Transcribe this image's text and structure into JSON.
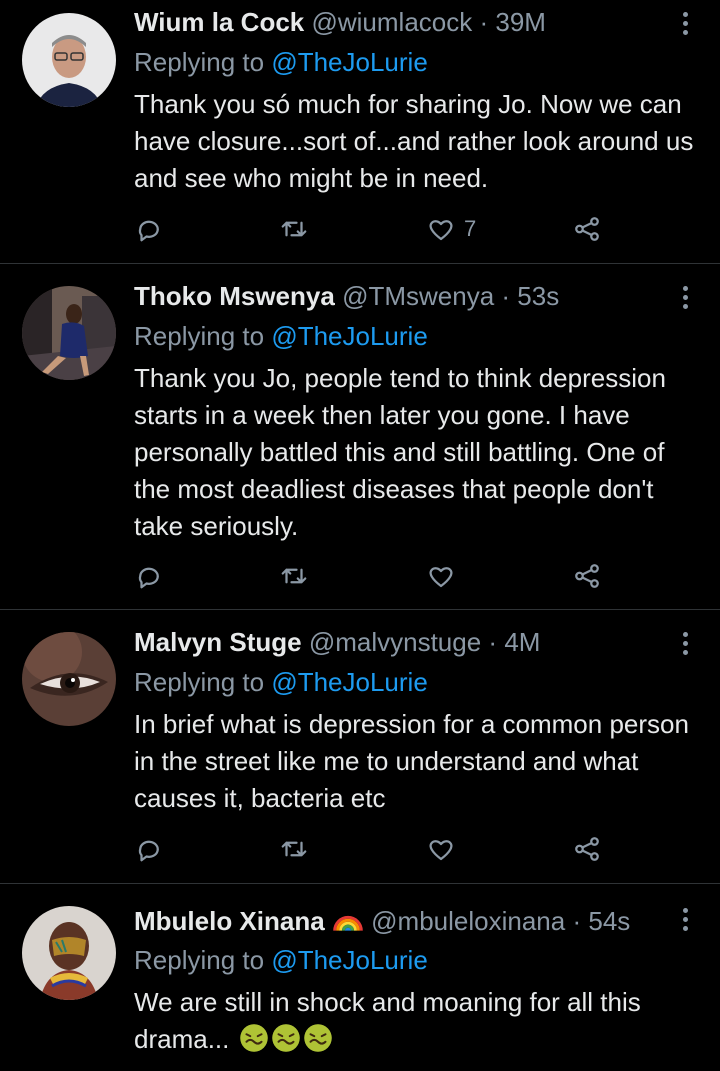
{
  "replying_prefix": "Replying to",
  "tweets": [
    {
      "name": "Wium la Cock",
      "handle": "@wiumlacock",
      "separator": "·",
      "time": "39M",
      "reply_to": "@TheJoLurie",
      "text": "Thank you só much for sharing Jo. Now we can have closure...sort of...and rather look around us and see who might be in need.",
      "like_count": "7"
    },
    {
      "name": "Thoko Mswenya",
      "handle": "@TMswenya",
      "separator": "·",
      "time": "53s",
      "reply_to": "@TheJoLurie",
      "text": "Thank you Jo, people tend to think depression starts in a week then later you gone. I have personally battled this and still battling. One of the most deadliest diseases that people don't take seriously.",
      "like_count": ""
    },
    {
      "name": "Malvyn Stuge",
      "handle": "@malvynstuge",
      "separator": "·",
      "time": "4M",
      "reply_to": "@TheJoLurie",
      "text": "In brief what is depression for a common person in the street like me to understand and what causes it, bacteria etc",
      "like_count": ""
    },
    {
      "name": "Mbulelo Xinana",
      "handle": "@mbuleloxinana",
      "separator": "·",
      "time": "54s",
      "reply_to": "@TheJoLurie",
      "text": "We are still in shock and moaning for all this drama...",
      "emojis": [
        "nauseated-face-emoji",
        "nauseated-face-emoji",
        "nauseated-face-emoji"
      ],
      "name_badge": "rainbow-emoji"
    }
  ],
  "icons": {
    "reply": "reply-icon",
    "retweet": "retweet-icon",
    "like": "heart-icon",
    "share": "share-icon",
    "more": "more-vertical-icon"
  },
  "colors": {
    "background": "#000000",
    "text": "#e7e9ea",
    "secondary": "#8b98a5",
    "link": "#1d9bf0",
    "divider": "#2f3336"
  }
}
